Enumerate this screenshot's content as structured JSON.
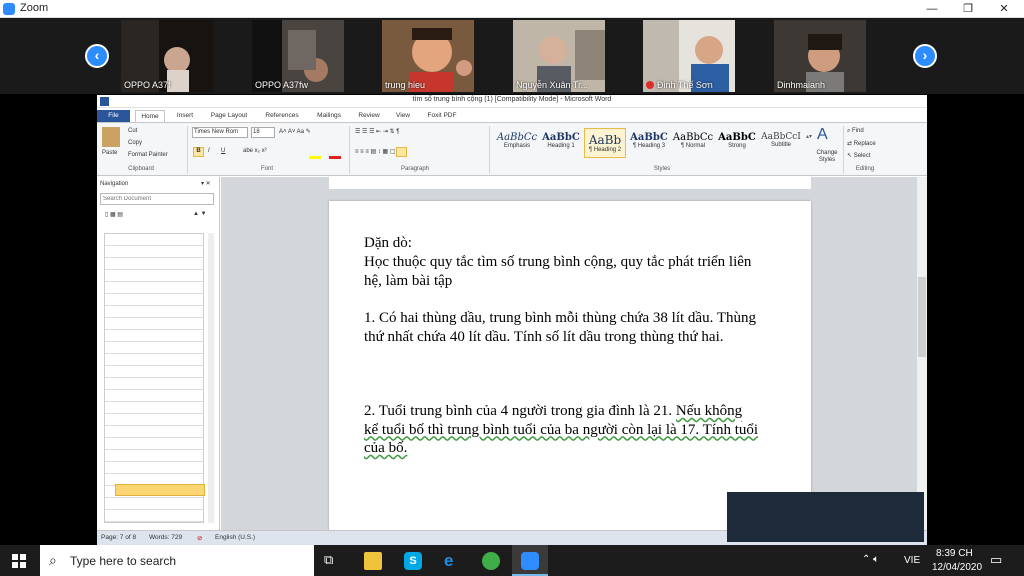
{
  "zoom": {
    "title": "Zoom",
    "minimize": "—",
    "restore": "❐",
    "close": "✕"
  },
  "participants": [
    {
      "name": "OPPO A37f"
    },
    {
      "name": "OPPO A37fw"
    },
    {
      "name": "trung hieu"
    },
    {
      "name": "Nguyễn Xuân Tr..."
    },
    {
      "name": "Đinh Thế Sơn"
    },
    {
      "name": "Dinhmaianh"
    }
  ],
  "word": {
    "title": "tìm số trung bình cộng (1) [Compatibility Mode] - Microsoft Word",
    "tabs": [
      "File",
      "Home",
      "Insert",
      "Page Layout",
      "References",
      "Mailings",
      "Review",
      "View",
      "Foxit PDF"
    ],
    "clipboard": {
      "paste": "Paste",
      "cut": "Cut",
      "copy": "Copy",
      "format_painter": "Format Painter",
      "label": "Clipboard"
    },
    "font": {
      "name": "Times New Rom",
      "size": "18",
      "label": "Font"
    },
    "paragraph_label": "Paragraph",
    "styles": [
      {
        "sample": "AaBbCc",
        "name": "Emphasis"
      },
      {
        "sample": "AaBbC",
        "name": "Heading 1"
      },
      {
        "sample": "AaBb",
        "name": "¶ Heading 2"
      },
      {
        "sample": "AaBbC",
        "name": "¶ Heading 3"
      },
      {
        "sample": "AaBbCc",
        "name": "¶ Normal"
      },
      {
        "sample": "AaBbC",
        "name": "Strong"
      },
      {
        "sample": "AaBbCcI",
        "name": "Subtitle"
      }
    ],
    "styles_label": "Styles",
    "change_styles": "Change Styles",
    "editing": {
      "find": "Find",
      "replace": "Replace",
      "select": "Select",
      "label": "Editing"
    },
    "nav": {
      "title": "Navigation",
      "search_placeholder": "Search Document"
    },
    "doc": {
      "heading": "Dặn dò:",
      "intro": "Học thuộc quy tắc tìm số trung bình cộng, quy tắc phát triển liên hệ, làm bài tập",
      "q1": "1. Có hai thùng dầu, trung bình mỗi thùng chứa 38 lít dầu. Thùng thứ nhất chứa 40 lít dầu. Tính số lít dầu trong thùng thứ hai.",
      "q2a": "2. Tuổi trung bình của 4 người trong gia đình là 21. ",
      "q2b": "Nếu không kể tuổi bố thì trung bình tuổi của ba người còn lại là 17. Tính tuổi của bố."
    },
    "status": {
      "page": "Page: 7 of 8",
      "words": "Words: 729",
      "lang": "English (U.S.)"
    }
  },
  "taskbar": {
    "search_text": "Type here to search",
    "lang": "VIE",
    "time": "8:39 CH",
    "date": "12/04/2020"
  },
  "colors": {
    "zoom_blue": "#2d8cff",
    "word_blue": "#2a5699",
    "taskbar": "#1c1c1c"
  }
}
